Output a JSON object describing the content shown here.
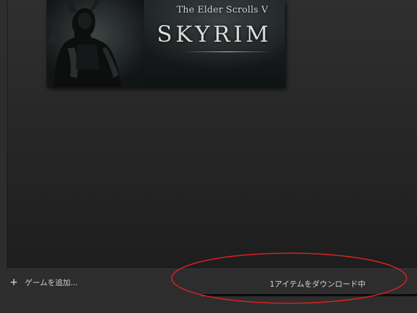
{
  "library": {
    "game_tile": {
      "subtitle": "The Elder Scrolls V",
      "title": "SKYRIM"
    }
  },
  "footer": {
    "add_game": {
      "icon": "plus-icon",
      "icon_glyph": "+",
      "label": "ゲームを追加..."
    },
    "download": {
      "status_text": "1アイテムをダウンロード中",
      "progress_fraction": 0.01
    }
  },
  "annotation": {
    "color": "#e02020"
  },
  "colors": {
    "background": "#2d2d2d",
    "panel": "#262626",
    "text": "#cfcfcf"
  }
}
